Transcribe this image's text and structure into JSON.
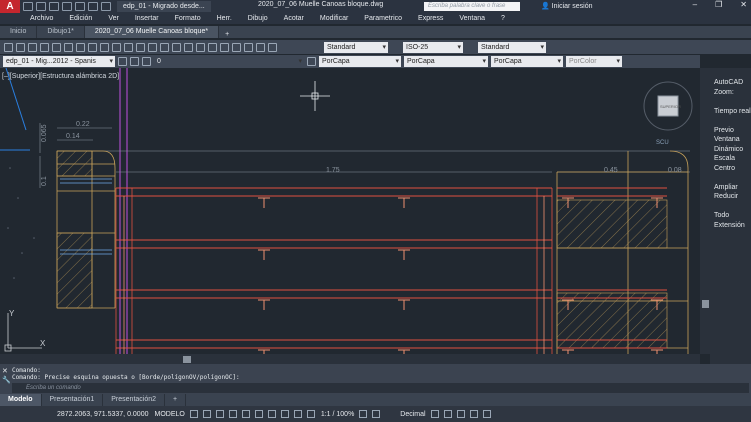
{
  "title_bar": {
    "app_logo": "A",
    "file_tab": "edp_01 - Migrado desde...",
    "window_title": "2020_07_06 Muelle Canoas bloque.dwg",
    "search_placeholder": "Escriba palabra clave o frase",
    "login": "Iniciar sesión"
  },
  "menu": [
    "Archivo",
    "Edición",
    "Ver",
    "Insertar",
    "Formato",
    "Herr.",
    "Dibujo",
    "Acotar",
    "Modificar",
    "Parametrico",
    "Express",
    "Ventana",
    "?"
  ],
  "doc_tabs": [
    {
      "label": "Inicio",
      "active": false
    },
    {
      "label": "Dibujo1*",
      "active": false
    },
    {
      "label": "2020_07_06 Muelle Canoas bloque*",
      "active": true
    }
  ],
  "toolbar": {
    "style1": "Standard",
    "dimstyle": "ISO-25",
    "style3": "Standard"
  },
  "layer_bar": {
    "workspace": "edp_01 - Mig...2012 - Spanis",
    "layer": "0",
    "color": "PorCapa",
    "linetype": "PorCapa",
    "lineweight": "PorCapa",
    "plotstyle": "PorColor"
  },
  "viewport_label": "[–][Superior][Estructura alámbrica 2D]",
  "viewcube": {
    "face": "SUPERIOR",
    "ucs": "SCU"
  },
  "drawing": {
    "dims": [
      "0.22",
      "0.14",
      "0.065",
      "0.1",
      "1.75",
      "0.45",
      "0.08"
    ]
  },
  "right_panel": [
    "AutoCAD",
    "Zoom:",
    "",
    "Tiempo real",
    "",
    "Previo",
    "Ventana",
    "Dinámico",
    "Escala",
    "Centro",
    "",
    "Ampliar",
    "Reducir",
    "",
    "Todo",
    "Extensión"
  ],
  "command": {
    "line1": "Comando:",
    "line2": "Comando: Precise esquina opuesta o [Borde/polígonOV/polígonOC]:",
    "input_placeholder": "Escriba un comando"
  },
  "layout_tabs": [
    {
      "label": "Modelo",
      "active": true
    },
    {
      "label": "Presentación1",
      "active": false
    },
    {
      "label": "Presentación2",
      "active": false
    }
  ],
  "status": {
    "coords": "2872.2063, 971.5337, 0.0000",
    "mode": "MODELO",
    "scale": "1:1 / 100%",
    "units": "Decimal"
  }
}
